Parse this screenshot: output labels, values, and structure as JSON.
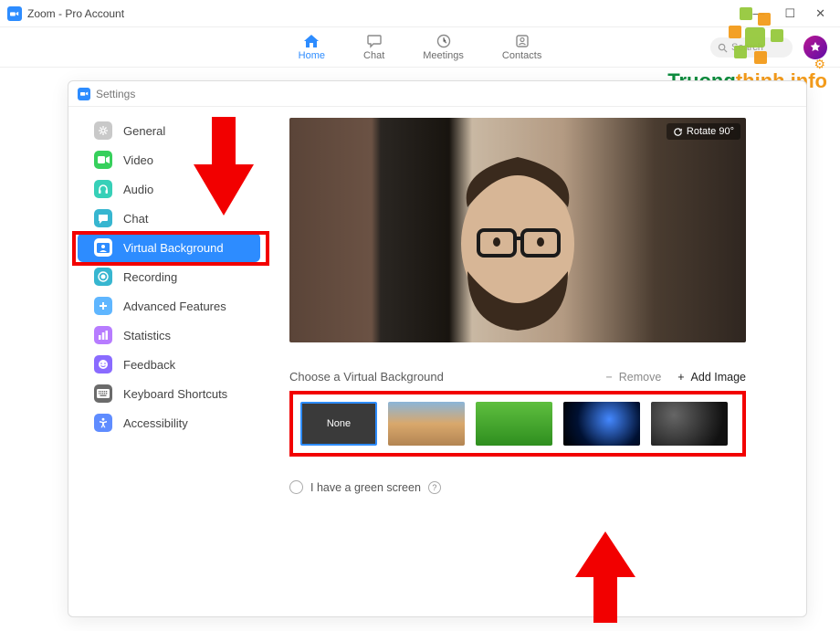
{
  "window": {
    "title": "Zoom - Pro Account"
  },
  "topnav": {
    "items": [
      {
        "label": "Home",
        "active": true
      },
      {
        "label": "Chat",
        "active": false
      },
      {
        "label": "Meetings",
        "active": false
      },
      {
        "label": "Contacts",
        "active": false
      }
    ],
    "search_placeholder": "Search"
  },
  "settings": {
    "title": "Settings",
    "sidebar": [
      {
        "label": "General",
        "icon": "gear-icon",
        "bg": "#c9c9c9"
      },
      {
        "label": "Video",
        "icon": "video-icon",
        "bg": "#37d05c"
      },
      {
        "label": "Audio",
        "icon": "headphones-icon",
        "bg": "#37d0b8"
      },
      {
        "label": "Chat",
        "icon": "chat-icon",
        "bg": "#37b6d0"
      },
      {
        "label": "Virtual Background",
        "icon": "user-card-icon",
        "bg": "#ffffff",
        "active": true
      },
      {
        "label": "Recording",
        "icon": "record-icon",
        "bg": "#37b6d0"
      },
      {
        "label": "Advanced Features",
        "icon": "plus-icon",
        "bg": "#5fb6ff"
      },
      {
        "label": "Statistics",
        "icon": "bars-icon",
        "bg": "#b77cff"
      },
      {
        "label": "Feedback",
        "icon": "smile-icon",
        "bg": "#8a6bff"
      },
      {
        "label": "Keyboard Shortcuts",
        "icon": "keyboard-icon",
        "bg": "#6b6b6b"
      },
      {
        "label": "Accessibility",
        "icon": "accessibility-icon",
        "bg": "#5f8cff"
      }
    ]
  },
  "vbg": {
    "rotate_label": "Rotate 90°",
    "choose_label": "Choose a Virtual Background",
    "remove_label": "Remove",
    "add_label": "Add Image",
    "none_label": "None",
    "green_screen_label": "I have a green screen"
  },
  "watermark": {
    "text1": "Truong",
    "text2": "thinh.info"
  }
}
